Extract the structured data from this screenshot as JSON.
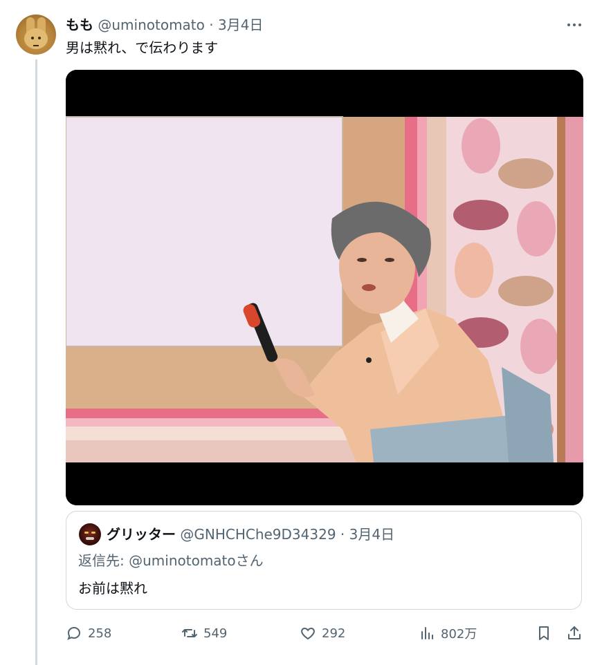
{
  "tweet": {
    "author_name": "もも",
    "author_handle": "@uminotomato",
    "separator": "·",
    "date": "3月4日",
    "text": "男は黙れ、で伝わります",
    "more_icon": "more-horizontal-icon"
  },
  "quote": {
    "author_name": "グリッター",
    "author_handle": "@GNHCHChe9D34329",
    "separator": "·",
    "date": "3月4日",
    "reply_prefix": "返信先: ",
    "reply_mention": "@uminotomato",
    "reply_suffix": "さん",
    "text": "お前は黙れ"
  },
  "actions": {
    "reply": {
      "icon": "reply-icon",
      "count": "258"
    },
    "retweet": {
      "icon": "retweet-icon",
      "count": "549"
    },
    "like": {
      "icon": "heart-icon",
      "count": "292"
    },
    "views": {
      "icon": "views-chart-icon",
      "count": "802万"
    },
    "bookmark": {
      "icon": "bookmark-icon"
    },
    "share": {
      "icon": "share-icon"
    }
  },
  "colors": {
    "text_primary": "#0f1419",
    "text_secondary": "#536471",
    "border": "#cfd9de",
    "media_letterbox": "#000000"
  }
}
